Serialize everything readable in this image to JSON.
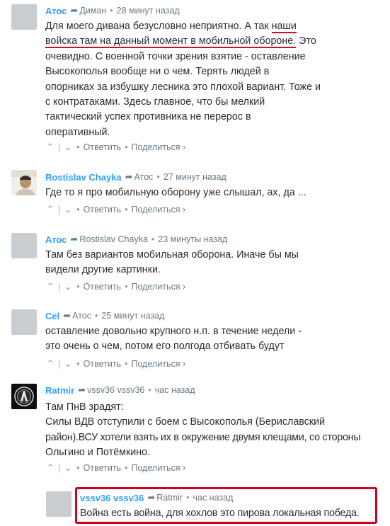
{
  "actions": {
    "reply": "Ответить",
    "share": "Поделиться ›"
  },
  "comments": [
    {
      "author": "Атос",
      "reply_to": "Диман",
      "time": "28 минут назад",
      "lines": [
        "Для моего дивана безусловно неприятно. А так ",
        "наши",
        "войска там на данный момент в мобильной обороне.",
        " Это",
        "очевидно. С военной точки зрения взятие - оставление",
        "Высокополья вообще ни о чем. Терять людей в",
        "опорниках за избушку лесника это плохой вариант. Тоже и",
        "с контратаками. Здесь главное, что бы мелкий",
        "тактический успех противника не перерос в",
        "оперативный."
      ]
    },
    {
      "author": "Rostislav Chayka",
      "reply_to": "Атос",
      "time": "27 минут назад",
      "lines": [
        "Где то я про мобильную оборону уже слышал, ах, да ..."
      ]
    },
    {
      "author": "Атос",
      "reply_to": "Rostislav Chayka",
      "time": "23 минуты назад",
      "lines": [
        "Там без вариантов мобильная оборона. Иначе бы мы",
        "видели другие картинки."
      ]
    },
    {
      "author": "Cel",
      "reply_to": "Атос",
      "time": "25 минут назад",
      "lines": [
        "оставление довольно крупного н.п. в течение недели -",
        "это очень о чем, потом его полгода отбивать будут"
      ]
    },
    {
      "author": "Ratmir",
      "reply_to": "vssv36 vssv36",
      "time": "час назад",
      "lines": [
        "Там ПнВ зрадят:",
        "Силы ВДВ отступили с боем с Высокополья (Бериславский",
        "район).ВСУ хотели взять их в окружение двумя клещами, со стороны",
        "Ольгино и Потёмкино."
      ]
    },
    {
      "author": "vssv36 vssv36",
      "reply_to": "Ratmir",
      "time": "час назад",
      "lines": [
        "Война есть война, для хохлов это пирова локальная победа."
      ]
    }
  ]
}
